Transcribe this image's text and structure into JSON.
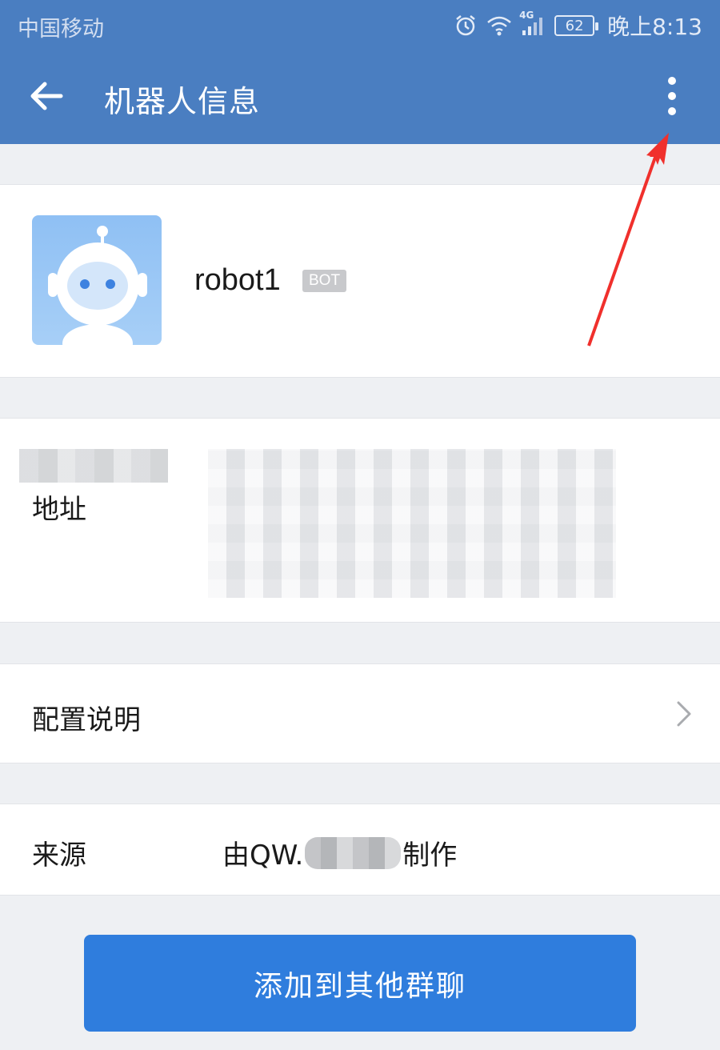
{
  "status_bar": {
    "carrier": "中国移动",
    "network": "4G",
    "battery": "62",
    "time": "晚上8:13",
    "icons": [
      "alarm-icon",
      "wifi-icon",
      "signal-icon",
      "battery-icon"
    ]
  },
  "app_bar": {
    "title": "机器人信息",
    "back_icon": "back-arrow-icon",
    "more_icon": "more-vertical-icon",
    "background": "#4a7ec1"
  },
  "profile": {
    "name": "robot1",
    "badge": "BOT",
    "avatar_icon": "robot-avatar-icon"
  },
  "address": {
    "label": "地址"
  },
  "config": {
    "label": "配置说明",
    "chevron_icon": "chevron-right-icon"
  },
  "source": {
    "label": "来源",
    "value_prefix": "由QW.",
    "value_suffix": "制作"
  },
  "add_button": {
    "label": "添加到其他群聊",
    "color": "#2f7ddd"
  },
  "annotation": {
    "arrow_color": "#f0302c"
  }
}
